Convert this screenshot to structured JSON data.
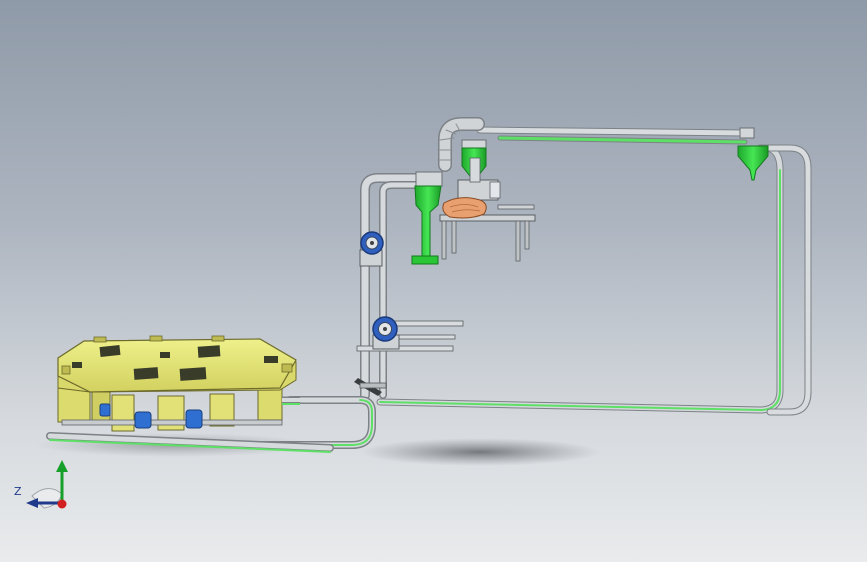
{
  "viewport": {
    "background_top": "#8f9aa8",
    "background_bottom": "#e9ebed"
  },
  "colors": {
    "pipe_gray": "#cfd3d6",
    "pipe_green": "#5ee067",
    "machine_yellow": "#e6e47a",
    "blower_blue": "#2f5fbf",
    "cyclone_green": "#2fcf3f",
    "cloth_orange": "#e8a070"
  },
  "triad": {
    "z_label": "Z",
    "y_color": "#16a02a",
    "z_color": "#1f3a8a",
    "origin_color": "#d21f1f"
  }
}
